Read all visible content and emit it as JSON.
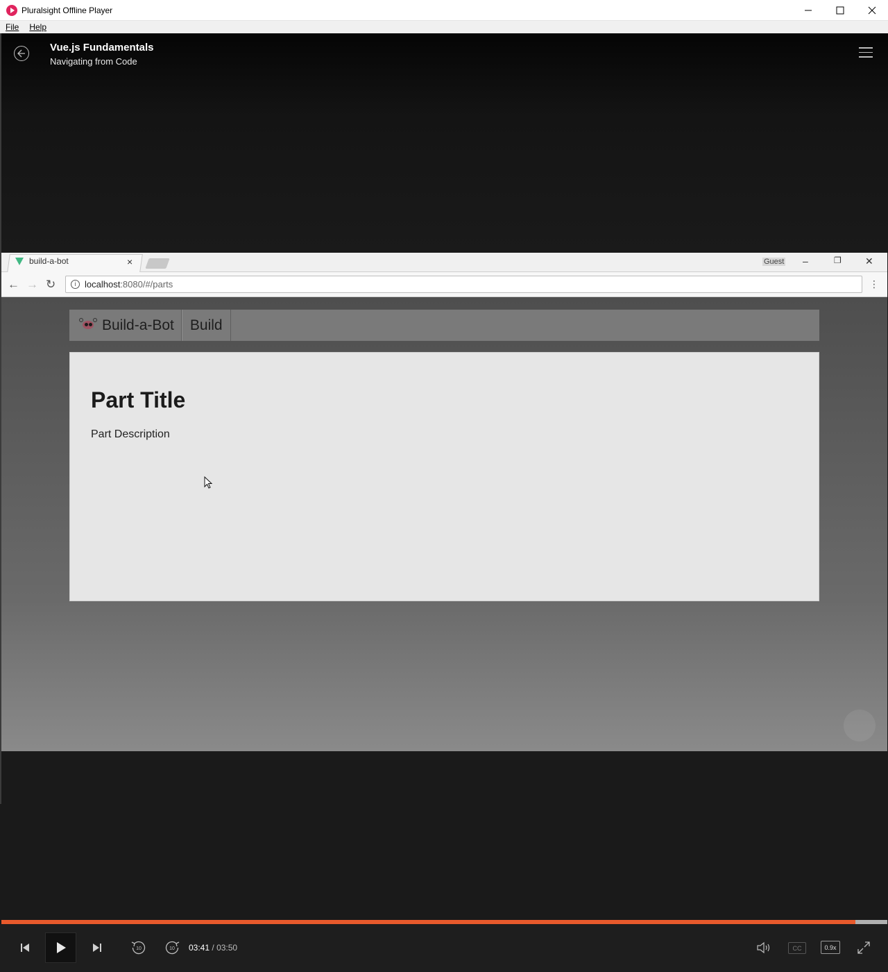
{
  "window": {
    "title": "Pluralsight Offline Player"
  },
  "menu": {
    "items": [
      "File",
      "Help"
    ]
  },
  "player": {
    "course_title": "Vue.js Fundamentals",
    "clip_title": "Navigating from Code",
    "current_time": "03:41",
    "separator": "/",
    "duration": "03:50",
    "progress_fraction": 0.964,
    "speed": "0.9x",
    "captions_label": "CC",
    "skip_back_seconds": "10",
    "skip_forward_seconds": "10",
    "accent_color": "#e85a2c"
  },
  "browser": {
    "tab_title": "build-a-bot",
    "profile_badge": "Guest",
    "url_host": "localhost",
    "url_path": ":8080/#/parts"
  },
  "webpage": {
    "brand": "Build-a-Bot",
    "nav_build": "Build",
    "part_title": "Part Title",
    "part_description": "Part Description"
  }
}
